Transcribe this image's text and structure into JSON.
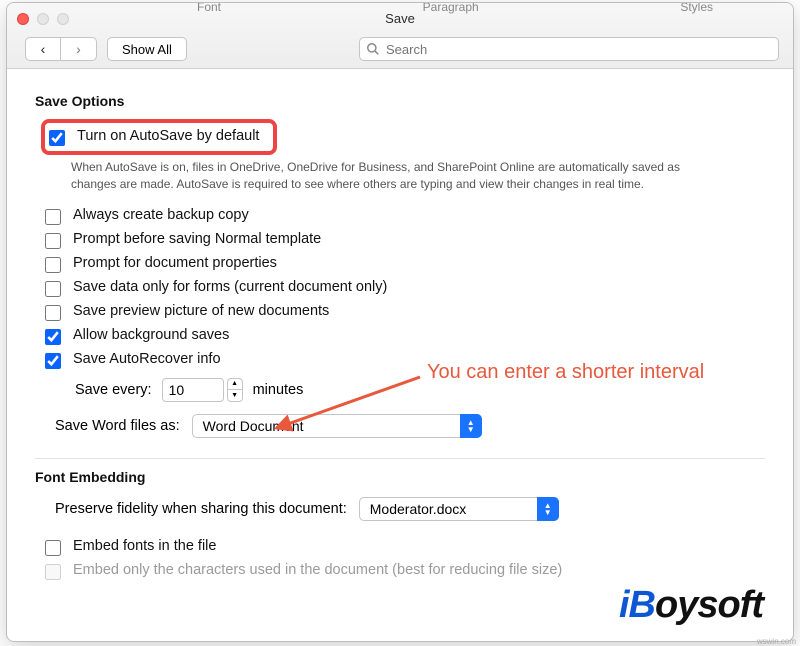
{
  "window": {
    "title": "Save"
  },
  "ribbon": {
    "tab1": "Font",
    "tab2": "Paragraph",
    "tab3": "Styles"
  },
  "nav": {
    "back": "‹",
    "forward": "›",
    "showall": "Show All"
  },
  "search": {
    "placeholder": "Search"
  },
  "sections": {
    "save_options": "Save Options",
    "font_embedding": "Font Embedding"
  },
  "options": {
    "autosave": "Turn on AutoSave by default",
    "autosave_help": "When AutoSave is on, files in OneDrive, OneDrive for Business, and SharePoint Online are automatically saved as changes are made. AutoSave is required to see where others are typing and view their changes in real time.",
    "backup": "Always create backup copy",
    "prompt_normal": "Prompt before saving Normal template",
    "prompt_props": "Prompt for document properties",
    "save_forms": "Save data only for forms (current document only)",
    "save_preview": "Save preview picture of new documents",
    "bg_saves": "Allow background saves",
    "autorecover": "Save AutoRecover info",
    "save_every_label": "Save every:",
    "save_every_value": "10",
    "minutes": "minutes",
    "save_as_label": "Save Word files as:",
    "save_as_value": "Word Document",
    "preserve_label": "Preserve fidelity when sharing this document:",
    "preserve_value": "Moderator.docx",
    "embed_fonts": "Embed fonts in the file",
    "embed_subset": "Embed only the characters used in the document (best for reducing file size)"
  },
  "annotation": {
    "text": "You can enter a shorter interval"
  },
  "watermark": {
    "text": "iBoysoft"
  },
  "corner": {
    "text": "wswin.com"
  }
}
